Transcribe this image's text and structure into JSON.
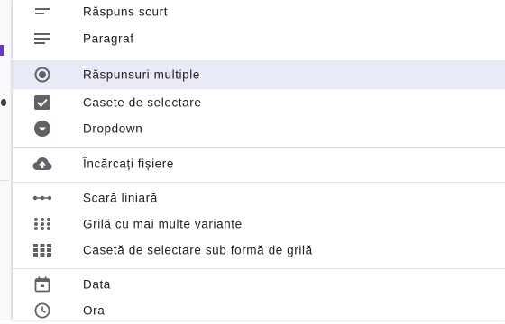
{
  "menu": {
    "items": [
      {
        "label": "Răspuns scurt",
        "icon": "short-answer-icon"
      },
      {
        "label": "Paragraf",
        "icon": "paragraph-icon"
      },
      {
        "label": "Răspunsuri multiple",
        "icon": "radio-button-icon",
        "selected": true
      },
      {
        "label": "Casete de selectare",
        "icon": "checkbox-icon"
      },
      {
        "label": "Dropdown",
        "icon": "dropdown-icon"
      },
      {
        "label": "Încărcați fișiere",
        "icon": "cloud-upload-icon"
      },
      {
        "label": "Scară liniară",
        "icon": "linear-scale-icon"
      },
      {
        "label": "Grilă cu mai multe variante",
        "icon": "multiple-choice-grid-icon"
      },
      {
        "label": "Casetă de selectare sub formă de grilă",
        "icon": "checkbox-grid-icon"
      },
      {
        "label": "Data",
        "icon": "calendar-icon"
      },
      {
        "label": "Ora",
        "icon": "clock-icon"
      }
    ]
  },
  "colors": {
    "selected_bg": "#e8eaf6",
    "icon": "#5f6368",
    "accent": "#673ab7"
  }
}
